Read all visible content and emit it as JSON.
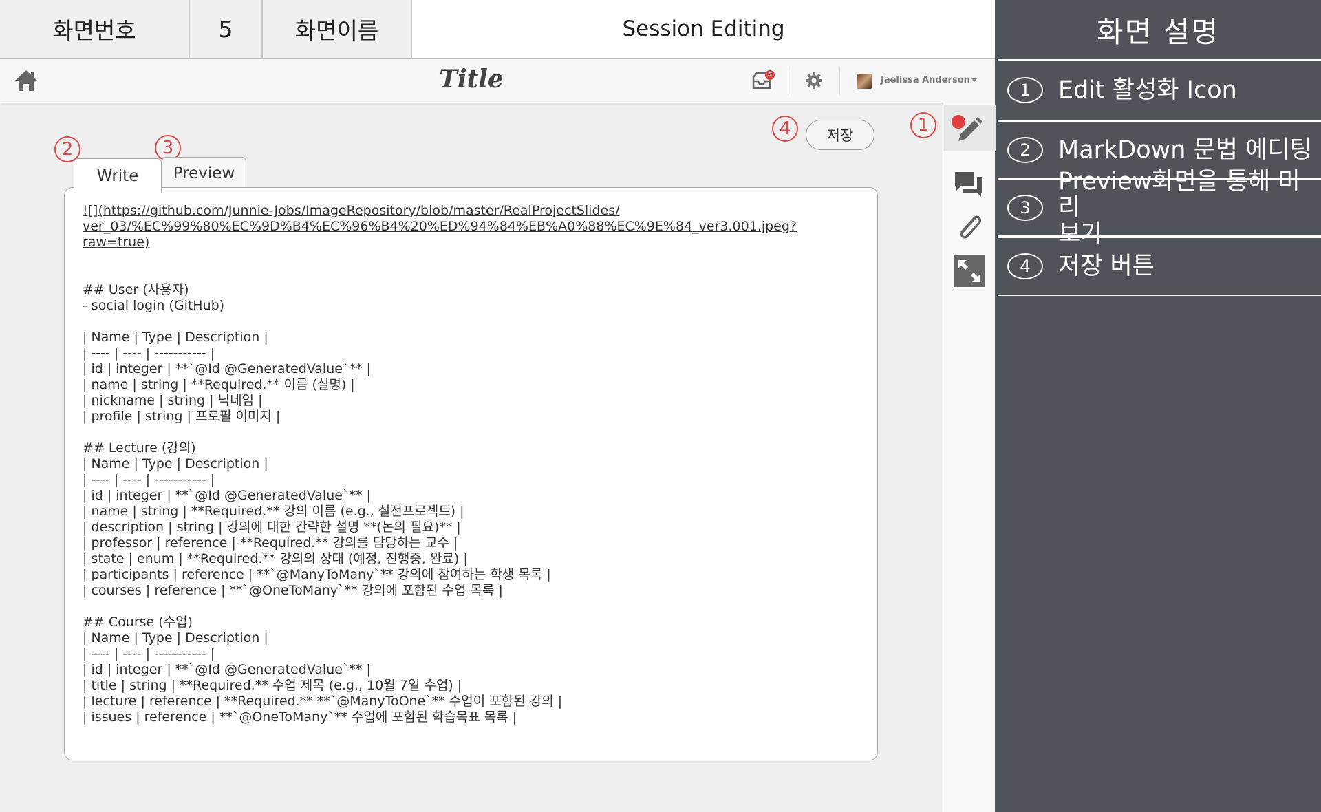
{
  "header": {
    "screen_number_label": "화면번호",
    "screen_number": "5",
    "screen_name_label": "화면이름",
    "screen_name": "Session Editing"
  },
  "description": {
    "title": "화면 설명",
    "items": [
      {
        "num": "1",
        "text": "Edit 활성화 Icon"
      },
      {
        "num": "2",
        "text": "MarkDown 문법 에디팅"
      },
      {
        "num": "3",
        "text": "Preview화면을 통해 미리\n보기"
      },
      {
        "num": "4",
        "text": "저장 버튼"
      }
    ]
  },
  "app": {
    "title": "Title",
    "notification_count": "5",
    "user_name": "Jaelissa Anderson",
    "save_label": "저장",
    "tabs": [
      {
        "label": "Write"
      },
      {
        "label": "Preview"
      }
    ],
    "markers": [
      "1",
      "2",
      "3",
      "4"
    ],
    "editor_link": "![](https://github.com/Junnie-Jobs/ImageRepository/blob/master/RealProjectSlides/\nver_03/%EC%99%80%EC%9D%B4%EC%96%B4%20%ED%94%84%EB%A0%88%EC%9E%84_ver3.001.jpeg?\nraw=true)",
    "editor_lines": [
      "",
      "",
      "## User (사용자)",
      "- social login (GitHub)",
      "",
      "| Name | Type | Description |",
      "| ---- | ---- | ----------- |",
      "| id | integer | **`@Id @GeneratedValue`** |",
      "| name | string | **Required.** 이름 (실명) |",
      "| nickname | string | 닉네임 |",
      "| profile | string | 프로필 이미지 |",
      "",
      "## Lecture (강의)",
      "| Name | Type | Description |",
      "| ---- | ---- | ----------- |",
      "| id | integer | **`@Id @GeneratedValue`** |",
      "| name | string | **Required.** 강의 이름 (e.g., 실전프로젝트) |",
      "| description | string | 강의에 대한 간략한 설명 **(논의 필요)** |",
      "| professor | reference | **Required.** 강의를 담당하는 교수 |",
      "| state | enum | **Required.** 강의의 상태 (예정, 진행중, 완료) |",
      "| participants | reference | **`@ManyToMany`** 강의에 참여하는 학생 목록 |",
      "| courses | reference | **`@OneToMany`** 강의에 포함된 수업 목록 |",
      "",
      "## Course (수업)",
      "| Name | Type | Description |",
      "| ---- | ---- | ----------- |",
      "| id | integer | **`@Id @GeneratedValue`** |",
      "| title | string | **Required.** 수업 제목 (e.g., 10월 7일 수업) |",
      "| lecture | reference | **Required.** **`@ManyToOne`** 수업이 포함된 강의 |",
      "| issues | reference | **`@OneToMany`** 수업에 포함된 학습목표 목록 |"
    ]
  },
  "icons": {
    "home": "home-icon",
    "inbox": "inbox-icon",
    "settings": "gear-icon",
    "edit": "pencil-icon",
    "comments": "chat-bubbles-icon",
    "attach": "paperclip-icon",
    "fullscreen": "expand-icon"
  },
  "colors": {
    "marker": "#d94b4b",
    "panel": "#50545a",
    "notification": "#e04040"
  }
}
